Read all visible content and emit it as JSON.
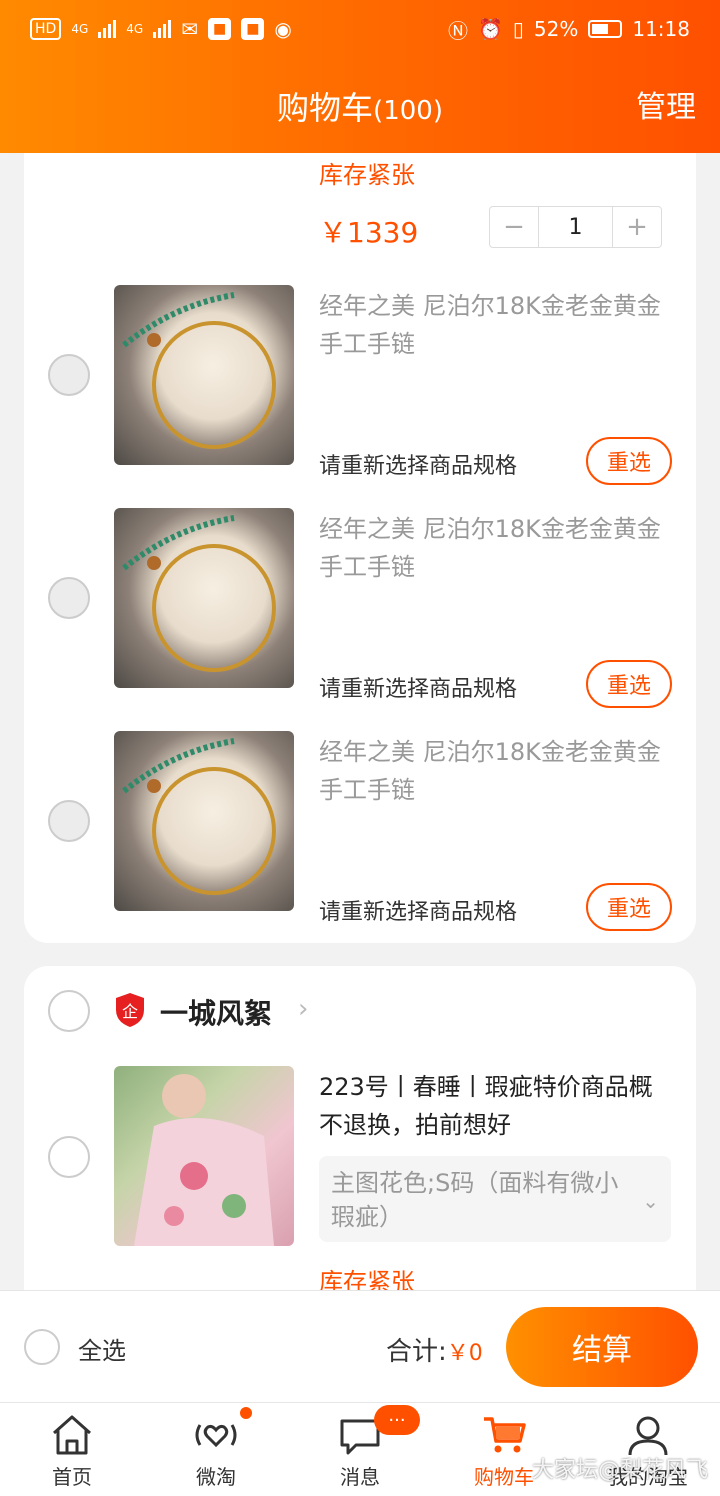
{
  "status_bar": {
    "left_chips": [
      "HD",
      "4G",
      "4G"
    ],
    "battery": "52%",
    "time": "11:18"
  },
  "header": {
    "title": "购物车",
    "count": "(100)",
    "manage": "管理"
  },
  "top_item": {
    "stock": "库存紧张",
    "price": "￥1339",
    "qty": "1",
    "minus": "−",
    "plus": "+"
  },
  "invalid_items": [
    {
      "name": "经年之美 尼泊尔18K金老金黄金手工手链",
      "hint": "请重新选择商品规格",
      "button": "重选"
    },
    {
      "name": "经年之美 尼泊尔18K金老金黄金手工手链",
      "hint": "请重新选择商品规格",
      "button": "重选"
    },
    {
      "name": "经年之美 尼泊尔18K金老金黄金手工手链",
      "hint": "请重新选择商品规格",
      "button": "重选"
    }
  ],
  "shop": {
    "icon_char": "企",
    "name": "一城风絮",
    "item": {
      "name": "223号丨春睡丨瑕疵特价商品概不退换，拍前想好",
      "spec": "主图花色;S码（面料有微小瑕疵）",
      "stock": "库存紧张"
    }
  },
  "bottom_bar": {
    "select_all": "全选",
    "total_label": "合计:",
    "total_value": "￥0",
    "checkout": "结算"
  },
  "tabs": [
    {
      "label": "首页",
      "icon": "home-icon"
    },
    {
      "label": "微淘",
      "icon": "heart-wave-icon"
    },
    {
      "label": "消息",
      "icon": "message-icon",
      "badge": "···"
    },
    {
      "label": "购物车",
      "icon": "cart-icon"
    },
    {
      "label": "我的淘宝",
      "icon": "person-icon"
    }
  ],
  "watermark": "大家坛@梨花风飞",
  "colors": {
    "brand": "#ff5000",
    "header_start": "#ff8a00"
  }
}
